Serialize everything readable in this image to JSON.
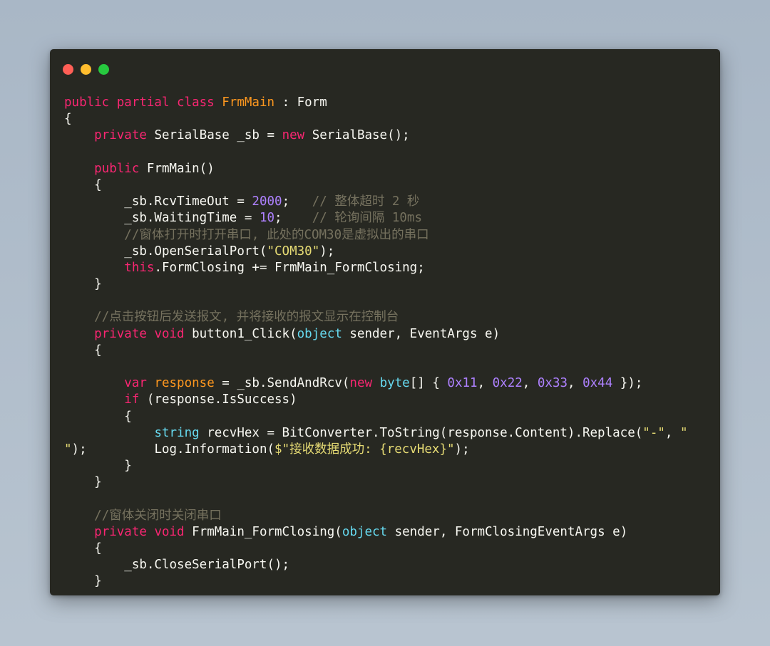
{
  "window": {
    "buttons": [
      "close",
      "minimize",
      "zoom"
    ],
    "colors": {
      "background": "#272822",
      "keyword": "#f92672",
      "class_name": "#fd971f",
      "string": "#e6db74",
      "number": "#ae81ff",
      "comment": "#75715e",
      "type": "#66d9ef",
      "plain": "#f8f8f2"
    }
  },
  "code_lines": [
    [
      [
        "kw",
        "public partial class "
      ],
      [
        "cls",
        "FrmMain"
      ],
      [
        "plain",
        " : Form"
      ]
    ],
    [
      [
        "plain",
        "{"
      ]
    ],
    [
      [
        "plain",
        "    "
      ],
      [
        "kw",
        "private"
      ],
      [
        "plain",
        " SerialBase _sb = "
      ],
      [
        "kw",
        "new"
      ],
      [
        "plain",
        " SerialBase();"
      ]
    ],
    [],
    [
      [
        "plain",
        "    "
      ],
      [
        "kw",
        "public"
      ],
      [
        "plain",
        " FrmMain()"
      ]
    ],
    [
      [
        "plain",
        "    {"
      ]
    ],
    [
      [
        "plain",
        "        _sb.RcvTimeOut = "
      ],
      [
        "num",
        "2000"
      ],
      [
        "plain",
        ";   "
      ],
      [
        "cmt",
        "// 整体超时 2 秒"
      ]
    ],
    [
      [
        "plain",
        "        _sb.WaitingTime = "
      ],
      [
        "num",
        "10"
      ],
      [
        "plain",
        ";    "
      ],
      [
        "cmt",
        "// 轮询间隔 10ms"
      ]
    ],
    [
      [
        "plain",
        "        "
      ],
      [
        "cmt",
        "//窗体打开时打开串口, 此处的COM30是虚拟出的串口"
      ]
    ],
    [
      [
        "plain",
        "        _sb.OpenSerialPort("
      ],
      [
        "str",
        "\"COM30\""
      ],
      [
        "plain",
        ");"
      ]
    ],
    [
      [
        "plain",
        "        "
      ],
      [
        "kw",
        "this"
      ],
      [
        "plain",
        ".FormClosing += FrmMain_FormClosing;"
      ]
    ],
    [
      [
        "plain",
        "    }"
      ]
    ],
    [],
    [
      [
        "plain",
        "    "
      ],
      [
        "cmt",
        "//点击按钮后发送报文, 并将接收的报文显示在控制台"
      ]
    ],
    [
      [
        "plain",
        "    "
      ],
      [
        "kw",
        "private void"
      ],
      [
        "plain",
        " button1_Click("
      ],
      [
        "type",
        "object"
      ],
      [
        "plain",
        " sender, EventArgs e)"
      ]
    ],
    [
      [
        "plain",
        "    {"
      ]
    ],
    [],
    [
      [
        "plain",
        "        "
      ],
      [
        "kw",
        "var"
      ],
      [
        "plain",
        " "
      ],
      [
        "cls",
        "response"
      ],
      [
        "plain",
        " = _sb.SendAndRcv("
      ],
      [
        "kw",
        "new"
      ],
      [
        "plain",
        " "
      ],
      [
        "type",
        "byte"
      ],
      [
        "plain",
        "[] { "
      ],
      [
        "num",
        "0x11"
      ],
      [
        "plain",
        ", "
      ],
      [
        "num",
        "0x22"
      ],
      [
        "plain",
        ", "
      ],
      [
        "num",
        "0x33"
      ],
      [
        "plain",
        ", "
      ],
      [
        "num",
        "0x44"
      ],
      [
        "plain",
        " });"
      ]
    ],
    [
      [
        "plain",
        "        "
      ],
      [
        "kw",
        "if"
      ],
      [
        "plain",
        " (response.IsSuccess)"
      ]
    ],
    [
      [
        "plain",
        "        {"
      ]
    ],
    [
      [
        "plain",
        "            "
      ],
      [
        "type",
        "string"
      ],
      [
        "plain",
        " recvHex = BitConverter.ToString(response.Content).Replace("
      ],
      [
        "str",
        "\"-\""
      ],
      [
        "plain",
        ", "
      ],
      [
        "str",
        "\""
      ]
    ],
    [
      [
        "str",
        "\""
      ],
      [
        "plain",
        ");         Log.Information("
      ],
      [
        "str",
        "$\"接收数据成功: {recvHex}\""
      ],
      [
        "plain",
        ");"
      ]
    ],
    [
      [
        "plain",
        "        }"
      ]
    ],
    [
      [
        "plain",
        "    }"
      ]
    ],
    [],
    [
      [
        "plain",
        "    "
      ],
      [
        "cmt",
        "//窗体关闭时关闭串口"
      ]
    ],
    [
      [
        "plain",
        "    "
      ],
      [
        "kw",
        "private void"
      ],
      [
        "plain",
        " FrmMain_FormClosing("
      ],
      [
        "type",
        "object"
      ],
      [
        "plain",
        " sender, FormClosingEventArgs e)"
      ]
    ],
    [
      [
        "plain",
        "    {"
      ]
    ],
    [
      [
        "plain",
        "        _sb.CloseSerialPort();"
      ]
    ],
    [
      [
        "plain",
        "    }"
      ]
    ]
  ]
}
